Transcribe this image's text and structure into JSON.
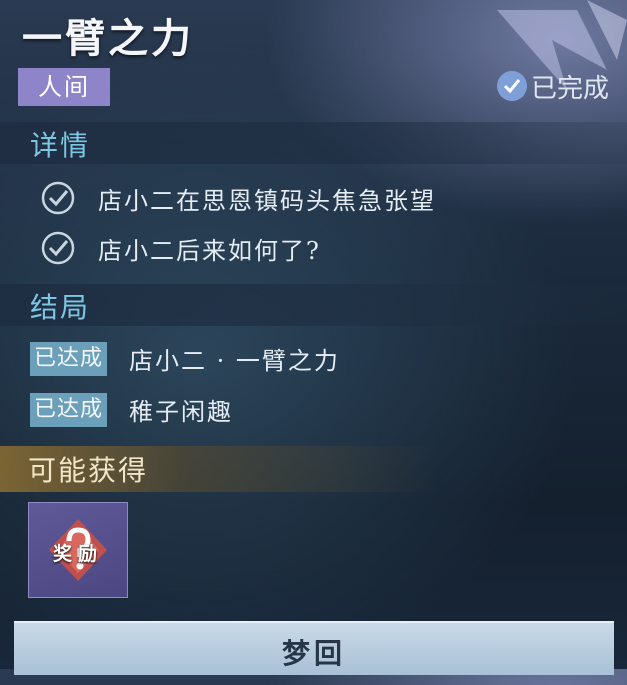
{
  "quest": {
    "title": "一臂之力",
    "region_tag": "人间",
    "status": "已完成"
  },
  "details": {
    "heading": "详情",
    "items": [
      {
        "text": "店小二在思恩镇码头焦急张望"
      },
      {
        "text": "店小二后来如何了?"
      }
    ]
  },
  "endings": {
    "heading": "结局",
    "items": [
      {
        "badge": "已达成",
        "text": "店小二 · 一臂之力"
      },
      {
        "badge": "已达成",
        "text": "稚子闲趣"
      }
    ]
  },
  "rewards": {
    "heading": "可能获得",
    "item_label": "奖励",
    "item_icon": "mystery-question-icon"
  },
  "action": {
    "button_label": "梦回"
  },
  "colors": {
    "region_tag": "#8e84c9",
    "section_heading": "#7fc6e3",
    "ending_badge": "#6b9fba",
    "reward_tile": "#5f5a98",
    "button": "#b8cde0"
  }
}
